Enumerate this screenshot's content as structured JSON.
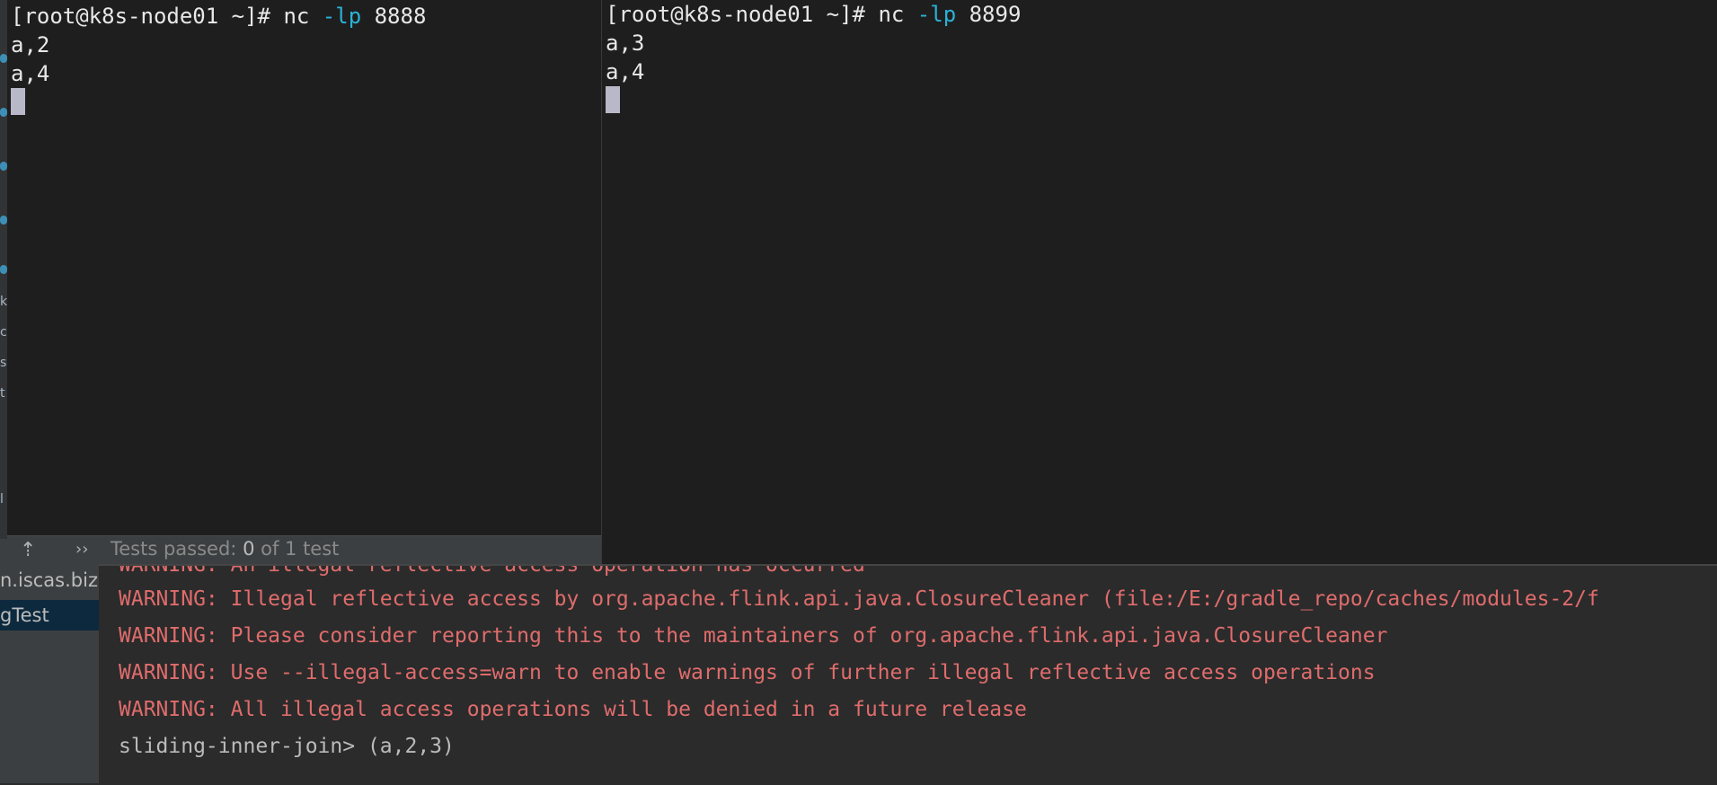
{
  "ide": {
    "sidebar_fragments": [
      "k",
      "c",
      "s",
      "t",
      "l"
    ],
    "project_tree": [
      {
        "label": "n.iscas.biz.t",
        "selected": false
      },
      {
        "label": "gTest",
        "selected": true
      }
    ],
    "test_status": {
      "prefix": "Tests passed: ",
      "passed": "0",
      "suffix": " of 1 test"
    }
  },
  "terminals": [
    {
      "prompt": "[root@k8s-node01 ~]# ",
      "command": "nc",
      "flag": "-lp",
      "port": "8888",
      "output": [
        "a,2",
        "a,4"
      ]
    },
    {
      "prompt": "[root@k8s-node01 ~]# ",
      "command": "nc",
      "flag": "-lp",
      "port": "8899",
      "output": [
        "a,3",
        "a,4"
      ]
    }
  ],
  "console": {
    "partial_line": "WARNING: An illegal reflective access operation has occurred",
    "warnings": [
      "WARNING: Illegal reflective access by org.apache.flink.api.java.ClosureCleaner (file:/E:/gradle_repo/caches/modules-2/f",
      "WARNING: Please consider reporting this to the maintainers of org.apache.flink.api.java.ClosureCleaner",
      "WARNING: Use --illegal-access=warn to enable warnings of further illegal reflective access operations",
      "WARNING: All illegal access operations will be denied in a future release"
    ],
    "output_line": "sliding-inner-join> (a,2,3)"
  },
  "colors": {
    "warning": "#e06c6c",
    "flag": "#2bb2d8",
    "terminal_bg": "#1e1e1e",
    "console_bg": "#2b2b2b"
  }
}
